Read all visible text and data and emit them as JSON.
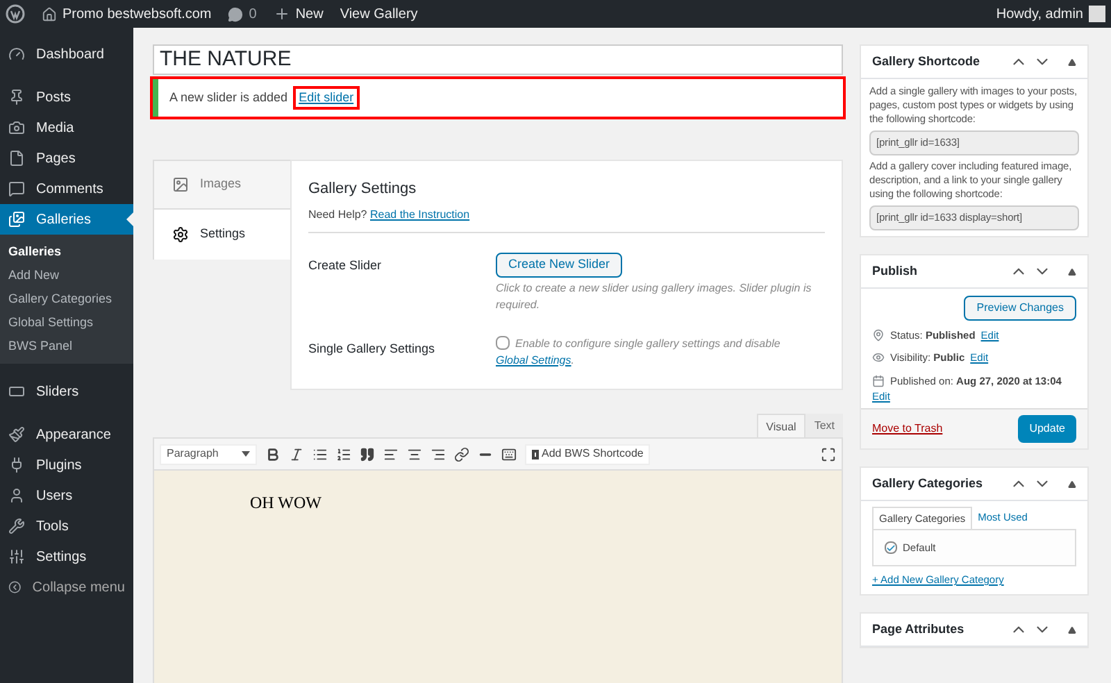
{
  "admin_bar": {
    "site": "Promo bestwebsoft.com",
    "comments": "0",
    "new": "New",
    "view": "View Gallery",
    "greeting": "Howdy, admin"
  },
  "sidebar": {
    "items": [
      {
        "label": "Dashboard",
        "selected": false
      },
      {
        "label": "Posts",
        "selected": false
      },
      {
        "label": "Media",
        "selected": false
      },
      {
        "label": "Pages",
        "selected": false
      },
      {
        "label": "Comments",
        "selected": false
      },
      {
        "label": "Galleries",
        "selected": true,
        "children": [
          {
            "label": "Galleries",
            "selected": true
          },
          {
            "label": "Add New",
            "selected": false
          },
          {
            "label": "Gallery Categories",
            "selected": false
          },
          {
            "label": "Global Settings",
            "selected": false
          },
          {
            "label": "BWS Panel",
            "selected": false
          }
        ]
      },
      {
        "label": "Sliders",
        "selected": false
      },
      {
        "label": "Appearance",
        "selected": false
      },
      {
        "label": "Plugins",
        "selected": false
      },
      {
        "label": "Users",
        "selected": false
      },
      {
        "label": "Tools",
        "selected": false
      },
      {
        "label": "Settings",
        "selected": false
      },
      {
        "label": "Collapse menu",
        "selected": false
      }
    ]
  },
  "title_field": {
    "value": "THE NATURE"
  },
  "notice": {
    "text": "A new slider is added",
    "link": "Edit slider"
  },
  "gallery_tabs": [
    {
      "label": "Images",
      "selected": false
    },
    {
      "label": "Settings",
      "selected": true
    }
  ],
  "settings": {
    "heading": "Gallery Settings",
    "help_text": "Need Help?",
    "help_link": "Read the Instruction",
    "rows": [
      {
        "kind": "button",
        "label": "Create Slider",
        "button": "Create New Slider",
        "description": "Click to create a new slider using gallery images. Slider plugin is required."
      },
      {
        "kind": "checkbox",
        "label": "Single Gallery Settings",
        "checked": false,
        "description": "Enable to configure single gallery settings and disable",
        "link": "Global Settings",
        "after": "."
      }
    ]
  },
  "editor": {
    "tabs": [
      {
        "label": "Visual",
        "selected": true
      },
      {
        "label": "Text",
        "selected": false
      }
    ],
    "format_select": "Paragraph",
    "shortcode_button": "Add BWS Shortcode",
    "content": "OH WOW"
  },
  "shortcode_box": {
    "title": "Gallery Shortcode",
    "text_1": "Add a single gallery with images to your posts, pages, custom post types or widgets by using the following shortcode:",
    "code_1": "[print_gllr id=1633]",
    "text_2": "Add a gallery cover including featured image, description, and a link to your single gallery using the following shortcode:",
    "code_2": "[print_gllr id=1633 display=short]"
  },
  "publish": {
    "title": "Publish",
    "preview_button": "Preview Changes",
    "status": "Status: **Published**",
    "status_link": "Edit",
    "visibility": "Visibility: **Public**",
    "visibility_link": "Edit",
    "published_on": "Published on: **Aug 27, 2020 at 13:04**",
    "published_link": "Edit",
    "trash_link": "Move to Trash",
    "update_button": "Update"
  },
  "categories": {
    "title": "Gallery Categories",
    "tabs": [
      {
        "label": "Gallery Categories",
        "selected": true
      },
      {
        "label": "Most Used",
        "selected": false
      }
    ],
    "items": [
      {
        "label": "Default",
        "checked": true
      }
    ],
    "add_link": "+ Add New Gallery Category"
  },
  "page_attributes": {
    "title": "Page Attributes"
  }
}
